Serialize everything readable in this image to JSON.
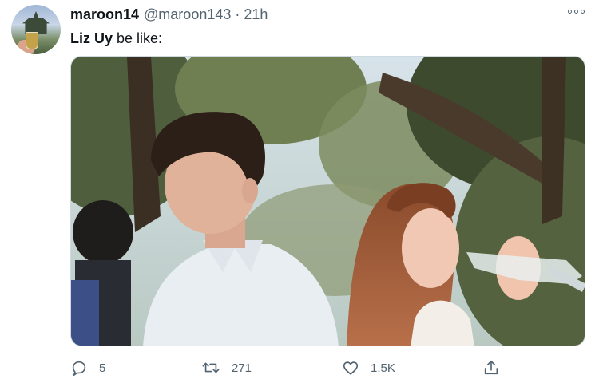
{
  "tweet": {
    "display_name": "maroon14",
    "handle": "@maroon143",
    "separator": "·",
    "time": "21h",
    "text_bold": "Liz Uy",
    "text_rest": " be like:"
  },
  "actions": {
    "reply_count": "5",
    "retweet_count": "271",
    "like_count": "1.5K"
  },
  "icons": {
    "more": "more-options-icon",
    "reply": "reply-icon",
    "retweet": "retweet-icon",
    "like": "heart-icon",
    "share": "share-icon"
  },
  "colors": {
    "text": "#0f1419",
    "secondary": "#536471",
    "border": "#cfd9de"
  }
}
